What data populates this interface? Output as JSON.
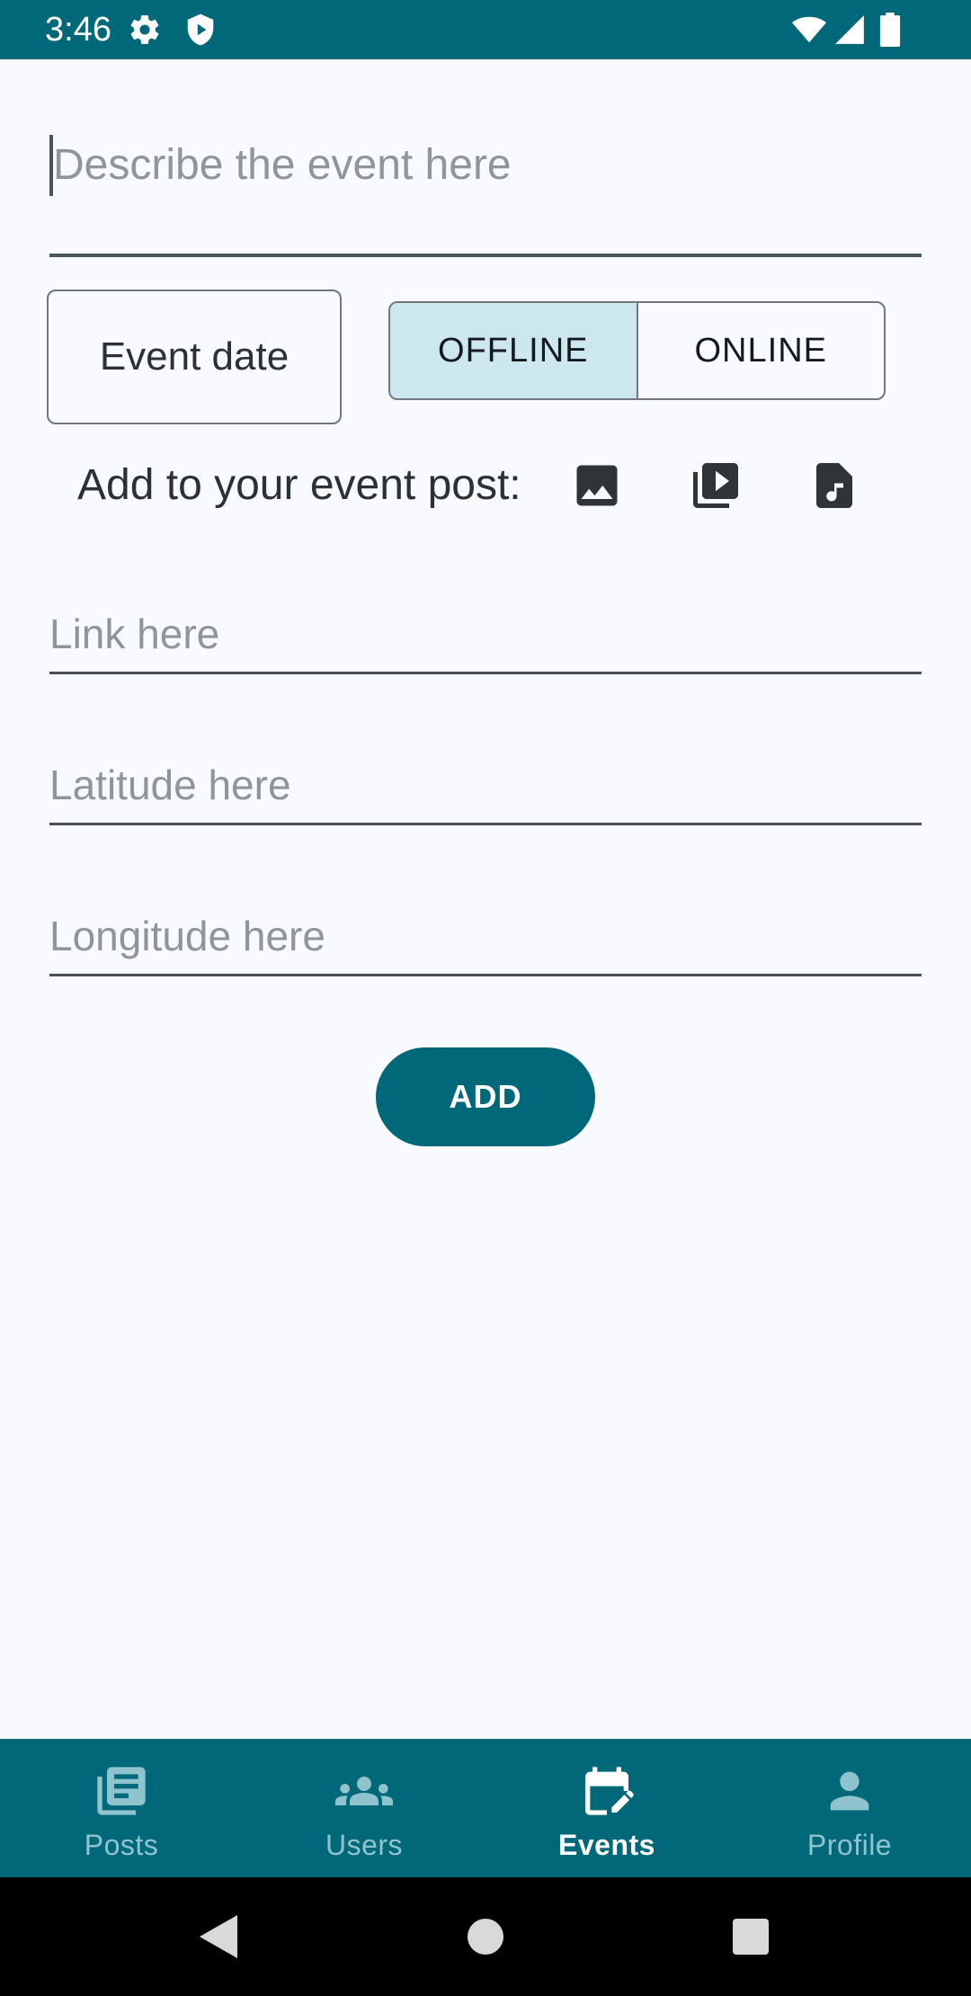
{
  "status_bar": {
    "time": "3:46",
    "left_icons": [
      "settings-icon",
      "shield-play-icon"
    ],
    "right_icons": [
      "wifi-icon",
      "signal-icon",
      "battery-icon"
    ],
    "color": "#006878"
  },
  "form": {
    "description": {
      "value": "",
      "placeholder": "Describe the event here"
    },
    "event_date_label": "Event date",
    "event_type": {
      "options": [
        "OFFLINE",
        "ONLINE"
      ],
      "selected": "OFFLINE"
    },
    "attach": {
      "label": "Add to your event post:",
      "icons": [
        "image-icon",
        "video-library-icon",
        "audio-file-icon"
      ]
    },
    "link": {
      "value": "",
      "placeholder": "Link here"
    },
    "latitude": {
      "value": "",
      "placeholder": "Latitude here"
    },
    "longitude": {
      "value": "",
      "placeholder": "Longitude here"
    },
    "add_label": "ADD"
  },
  "bottom_nav": {
    "items": [
      {
        "label": "Posts",
        "icon": "article-icon",
        "active": false
      },
      {
        "label": "Users",
        "icon": "group-icon",
        "active": false
      },
      {
        "label": "Events",
        "icon": "edit-calendar-icon",
        "active": true
      },
      {
        "label": "Profile",
        "icon": "person-icon",
        "active": false
      }
    ]
  },
  "system_nav": [
    "back-icon",
    "home-icon",
    "recents-icon"
  ],
  "colors": {
    "primary": "#006878",
    "selected_toggle": "#cde7ee",
    "background": "#f9fafd"
  }
}
